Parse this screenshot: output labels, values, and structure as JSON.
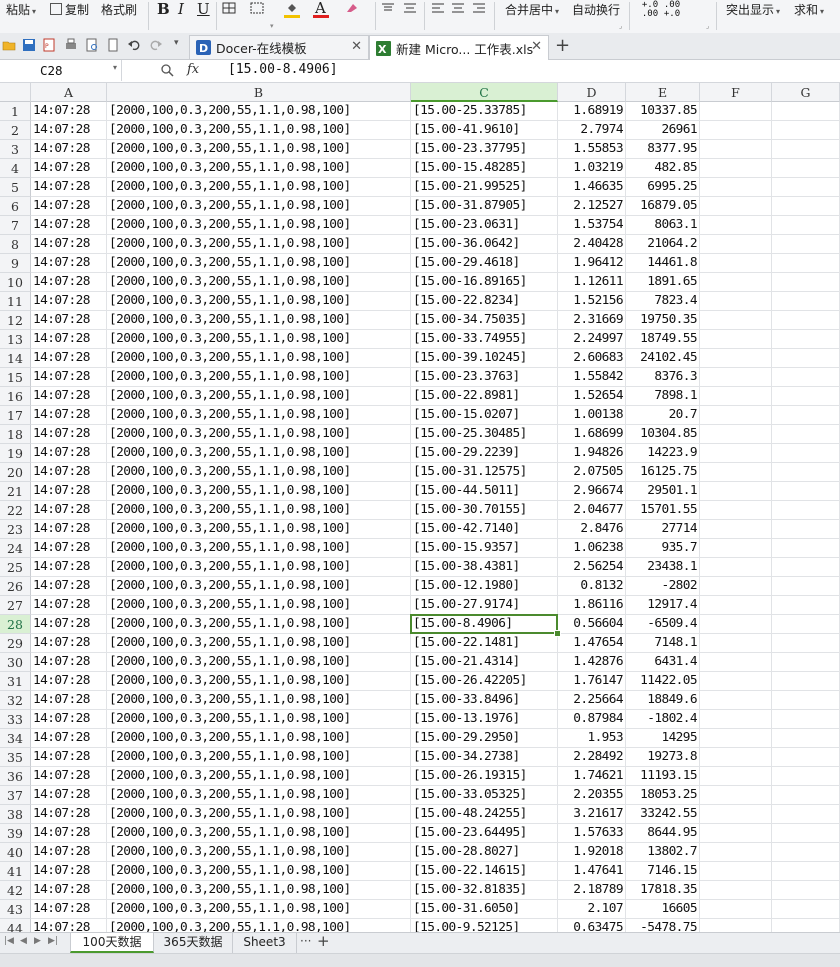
{
  "ribbon": {
    "paste": "粘贴",
    "copy": "复制",
    "format_painter": "格式刷",
    "bold": "B",
    "italic": "I",
    "underline": "U",
    "merge_center": "合并居中",
    "wrap_text": "自动换行",
    "decimal_increase": "+.0 .00",
    "decimal_decrease": ".00 +.0",
    "highlight": "突出显示",
    "sum": "求和"
  },
  "tabs": [
    {
      "label": "Docer-在线模板",
      "active": false
    },
    {
      "label": "新建 Micro... 工作表.xls",
      "active": true
    }
  ],
  "formula_bar": {
    "cell_ref": "C28",
    "fx": "fx",
    "content": "[15.00-8.4906]"
  },
  "columns": [
    "A",
    "B",
    "C",
    "D",
    "E",
    "F",
    "G"
  ],
  "selected": {
    "row": 28,
    "col": "C"
  },
  "rows": [
    {
      "n": "1",
      "a": "14:07:28",
      "b": "[2000,100,0.3,200,55,1.1,0.98,100]",
      "c": "[15.00-25.33785]",
      "d": "1.68919",
      "e": "10337.85"
    },
    {
      "n": "2",
      "a": "14:07:28",
      "b": "[2000,100,0.3,200,55,1.1,0.98,100]",
      "c": "[15.00-41.9610]",
      "d": "2.7974",
      "e": "26961"
    },
    {
      "n": "3",
      "a": "14:07:28",
      "b": "[2000,100,0.3,200,55,1.1,0.98,100]",
      "c": "[15.00-23.37795]",
      "d": "1.55853",
      "e": "8377.95"
    },
    {
      "n": "4",
      "a": "14:07:28",
      "b": "[2000,100,0.3,200,55,1.1,0.98,100]",
      "c": "[15.00-15.48285]",
      "d": "1.03219",
      "e": "482.85"
    },
    {
      "n": "5",
      "a": "14:07:28",
      "b": "[2000,100,0.3,200,55,1.1,0.98,100]",
      "c": "[15.00-21.99525]",
      "d": "1.46635",
      "e": "6995.25"
    },
    {
      "n": "6",
      "a": "14:07:28",
      "b": "[2000,100,0.3,200,55,1.1,0.98,100]",
      "c": "[15.00-31.87905]",
      "d": "2.12527",
      "e": "16879.05"
    },
    {
      "n": "7",
      "a": "14:07:28",
      "b": "[2000,100,0.3,200,55,1.1,0.98,100]",
      "c": "[15.00-23.0631]",
      "d": "1.53754",
      "e": "8063.1"
    },
    {
      "n": "8",
      "a": "14:07:28",
      "b": "[2000,100,0.3,200,55,1.1,0.98,100]",
      "c": "[15.00-36.0642]",
      "d": "2.40428",
      "e": "21064.2"
    },
    {
      "n": "9",
      "a": "14:07:28",
      "b": "[2000,100,0.3,200,55,1.1,0.98,100]",
      "c": "[15.00-29.4618]",
      "d": "1.96412",
      "e": "14461.8"
    },
    {
      "n": "10",
      "a": "14:07:28",
      "b": "[2000,100,0.3,200,55,1.1,0.98,100]",
      "c": "[15.00-16.89165]",
      "d": "1.12611",
      "e": "1891.65"
    },
    {
      "n": "11",
      "a": "14:07:28",
      "b": "[2000,100,0.3,200,55,1.1,0.98,100]",
      "c": "[15.00-22.8234]",
      "d": "1.52156",
      "e": "7823.4"
    },
    {
      "n": "12",
      "a": "14:07:28",
      "b": "[2000,100,0.3,200,55,1.1,0.98,100]",
      "c": "[15.00-34.75035]",
      "d": "2.31669",
      "e": "19750.35"
    },
    {
      "n": "13",
      "a": "14:07:28",
      "b": "[2000,100,0.3,200,55,1.1,0.98,100]",
      "c": "[15.00-33.74955]",
      "d": "2.24997",
      "e": "18749.55"
    },
    {
      "n": "14",
      "a": "14:07:28",
      "b": "[2000,100,0.3,200,55,1.1,0.98,100]",
      "c": "[15.00-39.10245]",
      "d": "2.60683",
      "e": "24102.45"
    },
    {
      "n": "15",
      "a": "14:07:28",
      "b": "[2000,100,0.3,200,55,1.1,0.98,100]",
      "c": "[15.00-23.3763]",
      "d": "1.55842",
      "e": "8376.3"
    },
    {
      "n": "16",
      "a": "14:07:28",
      "b": "[2000,100,0.3,200,55,1.1,0.98,100]",
      "c": "[15.00-22.8981]",
      "d": "1.52654",
      "e": "7898.1"
    },
    {
      "n": "17",
      "a": "14:07:28",
      "b": "[2000,100,0.3,200,55,1.1,0.98,100]",
      "c": "[15.00-15.0207]",
      "d": "1.00138",
      "e": "20.7"
    },
    {
      "n": "18",
      "a": "14:07:28",
      "b": "[2000,100,0.3,200,55,1.1,0.98,100]",
      "c": "[15.00-25.30485]",
      "d": "1.68699",
      "e": "10304.85"
    },
    {
      "n": "19",
      "a": "14:07:28",
      "b": "[2000,100,0.3,200,55,1.1,0.98,100]",
      "c": "[15.00-29.2239]",
      "d": "1.94826",
      "e": "14223.9"
    },
    {
      "n": "20",
      "a": "14:07:28",
      "b": "[2000,100,0.3,200,55,1.1,0.98,100]",
      "c": "[15.00-31.12575]",
      "d": "2.07505",
      "e": "16125.75"
    },
    {
      "n": "21",
      "a": "14:07:28",
      "b": "[2000,100,0.3,200,55,1.1,0.98,100]",
      "c": "[15.00-44.5011]",
      "d": "2.96674",
      "e": "29501.1"
    },
    {
      "n": "22",
      "a": "14:07:28",
      "b": "[2000,100,0.3,200,55,1.1,0.98,100]",
      "c": "[15.00-30.70155]",
      "d": "2.04677",
      "e": "15701.55"
    },
    {
      "n": "23",
      "a": "14:07:28",
      "b": "[2000,100,0.3,200,55,1.1,0.98,100]",
      "c": "[15.00-42.7140]",
      "d": "2.8476",
      "e": "27714"
    },
    {
      "n": "24",
      "a": "14:07:28",
      "b": "[2000,100,0.3,200,55,1.1,0.98,100]",
      "c": "[15.00-15.9357]",
      "d": "1.06238",
      "e": "935.7"
    },
    {
      "n": "25",
      "a": "14:07:28",
      "b": "[2000,100,0.3,200,55,1.1,0.98,100]",
      "c": "[15.00-38.4381]",
      "d": "2.56254",
      "e": "23438.1"
    },
    {
      "n": "26",
      "a": "14:07:28",
      "b": "[2000,100,0.3,200,55,1.1,0.98,100]",
      "c": "[15.00-12.1980]",
      "d": "0.8132",
      "e": "-2802"
    },
    {
      "n": "27",
      "a": "14:07:28",
      "b": "[2000,100,0.3,200,55,1.1,0.98,100]",
      "c": "[15.00-27.9174]",
      "d": "1.86116",
      "e": "12917.4"
    },
    {
      "n": "28",
      "a": "14:07:28",
      "b": "[2000,100,0.3,200,55,1.1,0.98,100]",
      "c": "[15.00-8.4906]",
      "d": "0.56604",
      "e": "-6509.4"
    },
    {
      "n": "29",
      "a": "14:07:28",
      "b": "[2000,100,0.3,200,55,1.1,0.98,100]",
      "c": "[15.00-22.1481]",
      "d": "1.47654",
      "e": "7148.1"
    },
    {
      "n": "30",
      "a": "14:07:28",
      "b": "[2000,100,0.3,200,55,1.1,0.98,100]",
      "c": "[15.00-21.4314]",
      "d": "1.42876",
      "e": "6431.4"
    },
    {
      "n": "31",
      "a": "14:07:28",
      "b": "[2000,100,0.3,200,55,1.1,0.98,100]",
      "c": "[15.00-26.42205]",
      "d": "1.76147",
      "e": "11422.05"
    },
    {
      "n": "32",
      "a": "14:07:28",
      "b": "[2000,100,0.3,200,55,1.1,0.98,100]",
      "c": "[15.00-33.8496]",
      "d": "2.25664",
      "e": "18849.6"
    },
    {
      "n": "33",
      "a": "14:07:28",
      "b": "[2000,100,0.3,200,55,1.1,0.98,100]",
      "c": "[15.00-13.1976]",
      "d": "0.87984",
      "e": "-1802.4"
    },
    {
      "n": "34",
      "a": "14:07:28",
      "b": "[2000,100,0.3,200,55,1.1,0.98,100]",
      "c": "[15.00-29.2950]",
      "d": "1.953",
      "e": "14295"
    },
    {
      "n": "35",
      "a": "14:07:28",
      "b": "[2000,100,0.3,200,55,1.1,0.98,100]",
      "c": "[15.00-34.2738]",
      "d": "2.28492",
      "e": "19273.8"
    },
    {
      "n": "36",
      "a": "14:07:28",
      "b": "[2000,100,0.3,200,55,1.1,0.98,100]",
      "c": "[15.00-26.19315]",
      "d": "1.74621",
      "e": "11193.15"
    },
    {
      "n": "37",
      "a": "14:07:28",
      "b": "[2000,100,0.3,200,55,1.1,0.98,100]",
      "c": "[15.00-33.05325]",
      "d": "2.20355",
      "e": "18053.25"
    },
    {
      "n": "38",
      "a": "14:07:28",
      "b": "[2000,100,0.3,200,55,1.1,0.98,100]",
      "c": "[15.00-48.24255]",
      "d": "3.21617",
      "e": "33242.55"
    },
    {
      "n": "39",
      "a": "14:07:28",
      "b": "[2000,100,0.3,200,55,1.1,0.98,100]",
      "c": "[15.00-23.64495]",
      "d": "1.57633",
      "e": "8644.95"
    },
    {
      "n": "40",
      "a": "14:07:28",
      "b": "[2000,100,0.3,200,55,1.1,0.98,100]",
      "c": "[15.00-28.8027]",
      "d": "1.92018",
      "e": "13802.7"
    },
    {
      "n": "41",
      "a": "14:07:28",
      "b": "[2000,100,0.3,200,55,1.1,0.98,100]",
      "c": "[15.00-22.14615]",
      "d": "1.47641",
      "e": "7146.15"
    },
    {
      "n": "42",
      "a": "14:07:28",
      "b": "[2000,100,0.3,200,55,1.1,0.98,100]",
      "c": "[15.00-32.81835]",
      "d": "2.18789",
      "e": "17818.35"
    },
    {
      "n": "43",
      "a": "14:07:28",
      "b": "[2000,100,0.3,200,55,1.1,0.98,100]",
      "c": "[15.00-31.6050]",
      "d": "2.107",
      "e": "16605"
    },
    {
      "n": "44",
      "a": "14:07:28",
      "b": "[2000,100,0.3,200,55,1.1,0.98,100]",
      "c": "[15.00-9.52125]",
      "d": "0.63475",
      "e": "-5478.75"
    }
  ],
  "sheet_tabs": [
    {
      "label": "100天数据",
      "active": true
    },
    {
      "label": "365天数据",
      "active": false
    },
    {
      "label": "Sheet3",
      "active": false
    }
  ],
  "sheet_more": "···",
  "add_sheet": "+",
  "colors": {
    "accent_green": "#4b9a2e",
    "selection_header": "#d9f0d3"
  }
}
